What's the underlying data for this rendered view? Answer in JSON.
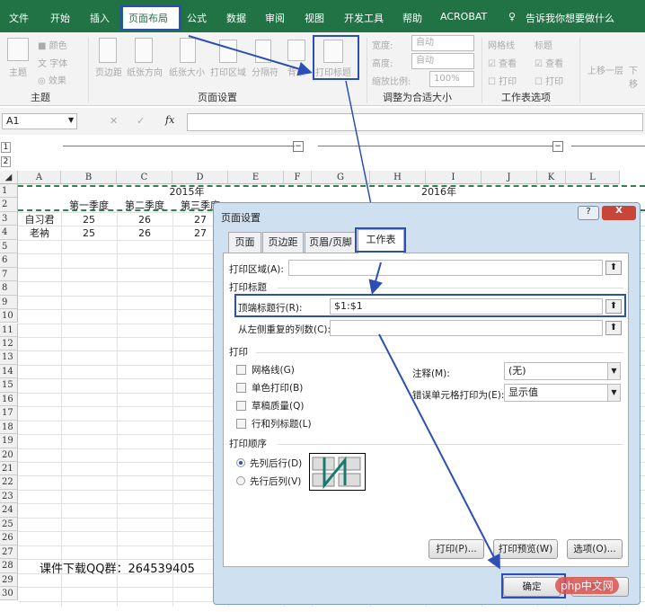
{
  "ribbon": {
    "tabs": [
      "文件",
      "开始",
      "插入",
      "页面布局",
      "公式",
      "数据",
      "审阅",
      "视图",
      "开发工具",
      "帮助",
      "ACROBAT"
    ],
    "active_tab": "页面布局",
    "tell_me": "告诉我你想要做什么",
    "theme": {
      "themes": "主题",
      "colors": "颜色",
      "fonts": "字体",
      "effects": "效果",
      "group": "主题"
    },
    "page_setup": {
      "margins": "页边距",
      "orientation": "纸张方向",
      "size": "纸张大小",
      "print_area": "打印区域",
      "breaks": "分隔符",
      "background": "背景",
      "print_titles": "打印标题",
      "group": "页面设置"
    },
    "scale": {
      "width_label": "宽度:",
      "width_value": "自动",
      "height_label": "高度:",
      "height_value": "自动",
      "scale_label": "缩放比例:",
      "scale_value": "100%",
      "group": "调整为合适大小"
    },
    "sheet_options": {
      "gridlines": "网格线",
      "headings": "标题",
      "view": "查看",
      "print": "打印",
      "group": "工作表选项"
    },
    "arrange": {
      "bring_forward": "上移一层",
      "send_backward": "下移"
    }
  },
  "formula_bar": {
    "name_box": "A1",
    "fx": "fx",
    "value": ""
  },
  "outline": {
    "levels": [
      "1",
      "2"
    ]
  },
  "sheet": {
    "columns": [
      "A",
      "B",
      "C",
      "D",
      "E",
      "F",
      "G",
      "H",
      "I",
      "J",
      "K",
      "L"
    ],
    "rows": [
      "1",
      "2",
      "3",
      "4",
      "5",
      "6",
      "7",
      "8",
      "9",
      "10",
      "11",
      "12",
      "13",
      "14",
      "15",
      "16",
      "17",
      "18",
      "19",
      "20",
      "21",
      "22",
      "23",
      "24",
      "25",
      "26",
      "27",
      "28",
      "29",
      "30"
    ],
    "year1": "2015年",
    "year2": "2016年",
    "headers": [
      "第一季度",
      "第二季度",
      "第三季度"
    ],
    "data": [
      [
        "自习君",
        "25",
        "26",
        "27"
      ],
      [
        "老衲",
        "25",
        "26",
        "27"
      ]
    ],
    "note": "课件下载QQ群：264539405"
  },
  "dialog": {
    "title": "页面设置",
    "help": "?",
    "close": "X",
    "tabs": [
      "页面",
      "页边距",
      "页眉/页脚",
      "工作表"
    ],
    "active_tab": "工作表",
    "print_area_label": "打印区域(A):",
    "print_area_value": "",
    "print_titles_section": "打印标题",
    "rows_repeat_label": "顶端标题行(R):",
    "rows_repeat_value": "$1:$1",
    "cols_repeat_label": "从左侧重复的列数(C):",
    "cols_repeat_value": "",
    "print_section": "打印",
    "checks": [
      "网格线(G)",
      "单色打印(B)",
      "草稿质量(Q)",
      "行和列标题(L)"
    ],
    "comments_label": "注释(M):",
    "comments_value": "(无)",
    "errors_label": "错误单元格打印为(E):",
    "errors_value": "显示值",
    "order_section": "打印顺序",
    "order_options": [
      "先列后行(D)",
      "先行后列(V)"
    ],
    "order_selected": 0,
    "print_btn": "打印(P)...",
    "preview_btn": "打印预览(W)",
    "options_btn": "选项(O)...",
    "ok_btn": "确定",
    "cancel_btn": "取消"
  },
  "watermark": "php中文网",
  "colors": {
    "excel_green": "#217346",
    "highlight": "#2b4fb5"
  }
}
